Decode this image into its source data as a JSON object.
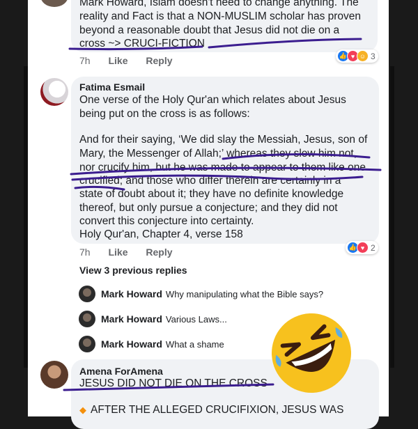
{
  "comment1": {
    "author_partial": "Mark Howard, Islam doesn't need to change anything. The",
    "lines": [
      "reality and Fact is that a NON-MUSLIM scholar has proven",
      "beyond a reasonable doubt that Jesus did not die on a",
      "cross ~> CRUCI-FICTION"
    ],
    "time": "7h",
    "like": "Like",
    "reply": "Reply",
    "reaction_count": "3"
  },
  "comment2": {
    "author": "Fatima Esmail",
    "lines": [
      "One verse of the Holy Qur'an which relates about Jesus",
      "being put on the cross is as follows:",
      "",
      "And for their saying, ‘We did slay the Messiah, Jesus, son of",
      "Mary, the Messenger of Allah;’ whereas they slew him not,",
      "nor crucify him, but he was made to appear to them like one",
      "crucified; and those who differ therein are certainly in a",
      "state of doubt about it; they have no definite knowledge",
      "thereof, but only pursue a conjecture; and they did not",
      "convert this conjecture into certainty.",
      "Holy Qur'an, Chapter 4, verse 158"
    ],
    "time": "7h",
    "like": "Like",
    "reply": "Reply",
    "reaction_count": "2"
  },
  "replies": {
    "view_previous": "View 3 previous replies",
    "items": [
      {
        "name": "Mark Howard",
        "text": "Why manipulating what the Bible says?"
      },
      {
        "name": "Mark Howard",
        "text": "Various Laws..."
      },
      {
        "name": "Mark Howard",
        "text": "What a shame"
      }
    ]
  },
  "comment3": {
    "author": "Amena ForAmena",
    "line1": "JESUS DID NOT DIE ON THE CROSS",
    "line2": "AFTER THE ALLEGED CRUCIFIXION, JESUS WAS"
  },
  "colors": {
    "like_blue": "#1877f2",
    "love_red": "#f33e58",
    "haha_yellow": "#f7b125",
    "ink_purple": "#3b1d8f"
  },
  "icons": {
    "emoji": "rolling-laughing-emoji",
    "bullet": "orange-diamond-icon"
  }
}
